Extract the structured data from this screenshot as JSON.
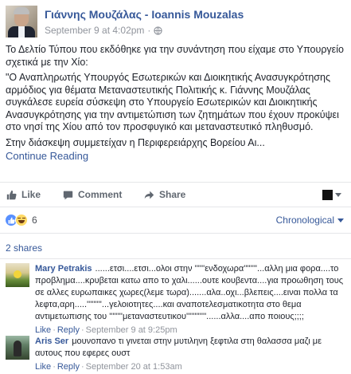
{
  "post": {
    "author": "Γιάννης Μουζάλας - Ioannis Mouzalas",
    "timestamp": "September 9 at 4:02pm",
    "paragraphs": [
      "Το Δελτίο Τύπου που εκδόθηκε για την συνάντηση που είχαμε στο Υπουργείο σχετικά με την Χίο:",
      "\"Ο Αναπληρωτής Υπουργός Εσωτερικών και Διοικητικής Ανασυγκρότησης αρμόδιος για θέματα Μεταναστευτικής Πολιτικής κ. Γιάννης Μουζάλας συγκάλεσε ευρεία σύσκεψη στο Υπουργείο Εσωτερικών και Διοικητικής Ανασυγκρότησης για την αντιμετώπιση των ζητημάτων που έχουν προκύψει στο νησί της Χίου από τον προσφυγικό και μεταναστευτικό πληθυσμό.",
      "Στην διάσκεψη συμμετείχαν η Περιφερειάρχης Βορείου Αι..."
    ],
    "continue_label": "Continue Reading"
  },
  "actions": {
    "like": "Like",
    "comment": "Comment",
    "share": "Share"
  },
  "reactions": {
    "count": "6",
    "sort_label": "Chronological"
  },
  "shares_label": "2 shares",
  "comments": [
    {
      "name": "Mary Petrakis",
      "text": "......ετσι....ετσι...ολοι στην ''''''ενδοχωρα''''''''...αλλη μια φορα....το προβλημα....κρυβεται κατω απο το χαλι......ουτε κουβεντα....για προωθηση τους σε αλλες ευρωπαικες χωρες(λεμε τωρα).......αλα..οχι...βλεπεις....ειναι πολλα τα λεφτα,αρη.....'''''''''...γελοιοτητες....και αναποτελεσματικοτητα στο θεμα αντιμετωπισης του ''''''''μεταναστευτικου''''''''''''......αλλα....απο ποιους;;;;",
      "like": "Like",
      "reply": "Reply",
      "time": "September 9 at 9:25pm"
    },
    {
      "name": "Aris Ser",
      "text": "μουνοπανο τι γινεται στην μυτιληνη ξεφτιλα στη θαλασσα μαζι με αυτους που εφερες ουστ",
      "like": "Like",
      "reply": "Reply",
      "time": "September 20 at 1:53am"
    }
  ],
  "colors": {
    "link": "#365899",
    "meta": "#90949c",
    "text": "#1d2129",
    "like_reaction": "#5890ff",
    "haha_reaction": "#ffd964"
  },
  "icons": [
    "globe-icon",
    "like-icon",
    "comment-icon",
    "share-icon",
    "audience-icon",
    "like-reaction-icon",
    "haha-reaction-icon",
    "chevron-down-icon"
  ]
}
